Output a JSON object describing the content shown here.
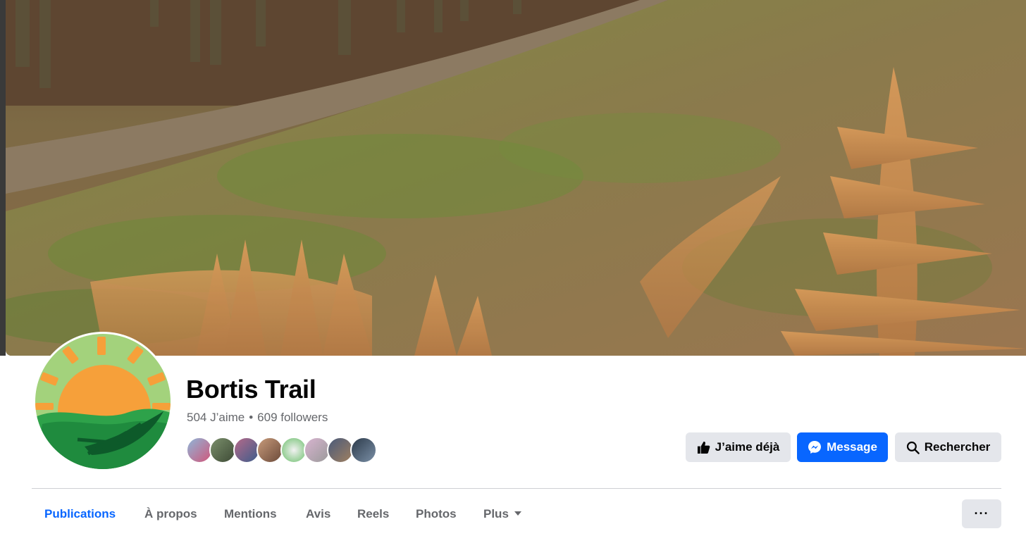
{
  "page": {
    "name": "Bortis Trail",
    "likes": "504 J’aime",
    "separator": "•",
    "followers": "609 followers"
  },
  "cover": {
    "description_icon": "cover-photo"
  },
  "actions": {
    "like_label": "J’aime déjà",
    "message_label": "Message",
    "search_label": "Rechercher",
    "like_icon": "thumbs-up-icon",
    "message_icon": "messenger-icon",
    "search_icon": "magnifier-icon"
  },
  "tabs": [
    {
      "label": "Publications",
      "active": true
    },
    {
      "label": "À propos",
      "active": false
    },
    {
      "label": "Mentions",
      "active": false
    },
    {
      "label": "Avis",
      "active": false
    },
    {
      "label": "Reels",
      "active": false
    },
    {
      "label": "Photos",
      "active": false
    },
    {
      "label": "Plus",
      "active": false
    }
  ],
  "more_label": "···",
  "colors": {
    "accent": "#0866ff",
    "secondary_button": "#e4e6eb",
    "muted_text": "#65676b"
  }
}
